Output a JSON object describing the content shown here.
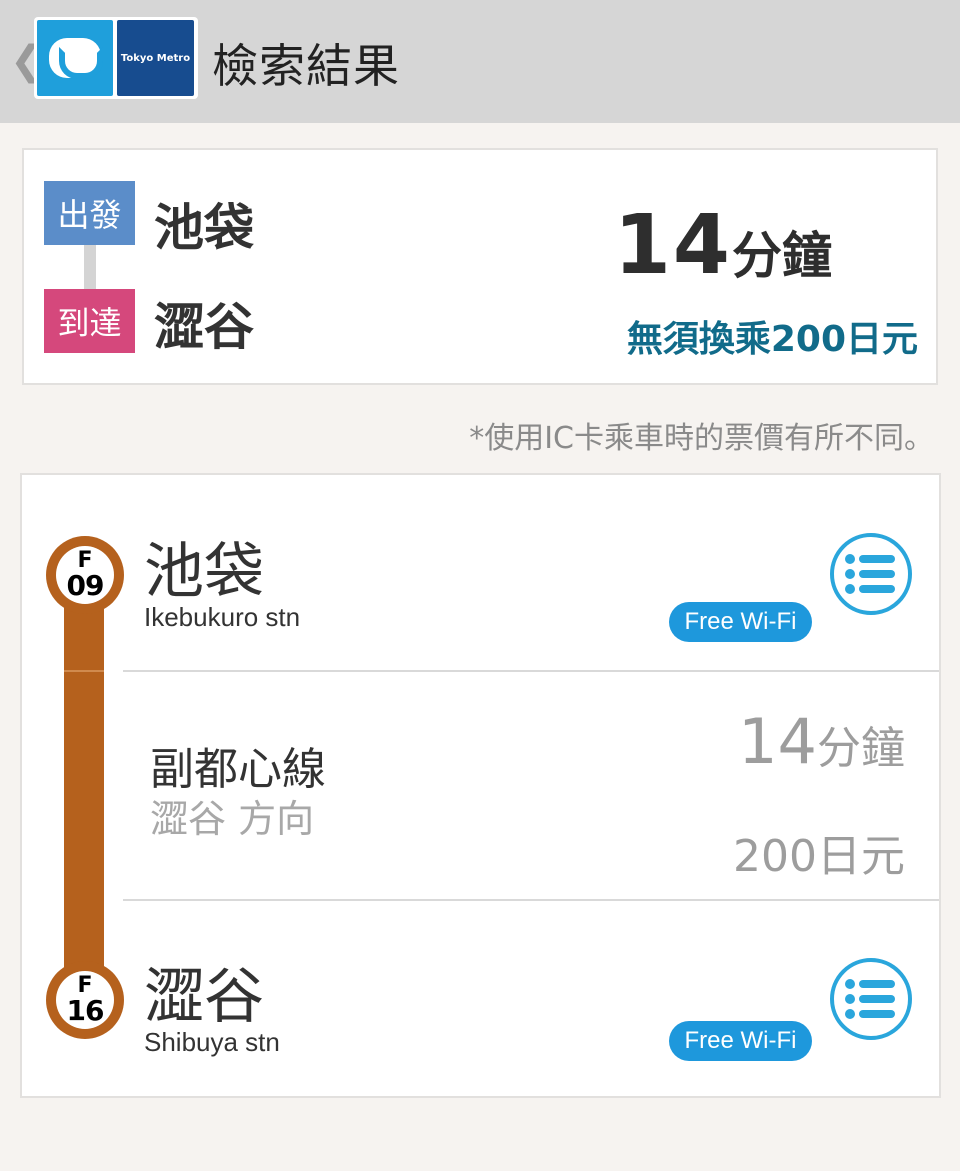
{
  "header": {
    "back_glyph": "❮",
    "logo_brand_text": "Tokyo Metro",
    "title": "檢索結果"
  },
  "summary": {
    "departure_tag": "出發",
    "departure_station": "池袋",
    "arrival_tag": "到達",
    "arrival_station": "澀谷",
    "duration_value": "14",
    "duration_unit": "分鐘",
    "fare_text": "無須換乘200日元"
  },
  "note": "*使用IC卡乘車時的票價有所不同。",
  "route": {
    "line_color": "#b5611d",
    "start": {
      "code_letter": "F",
      "code_number": "09",
      "name": "池袋",
      "name_en": "Ikebukuro stn",
      "wifi_label": "Free Wi-Fi",
      "menu_icon": "list-icon"
    },
    "segment": {
      "line_name": "副都心線",
      "direction": "澀谷 方向",
      "duration_value": "14",
      "duration_unit": "分鐘",
      "fare": "200日元"
    },
    "end": {
      "code_letter": "F",
      "code_number": "16",
      "name": "澀谷",
      "name_en": "Shibuya stn",
      "wifi_label": "Free Wi-Fi",
      "menu_icon": "list-icon"
    }
  },
  "colors": {
    "header_bg": "#d6d6d6",
    "departure_tag": "#5b8dc9",
    "arrival_tag": "#d5487c",
    "fare_accent": "#116b8a",
    "wifi_badge": "#1e98dc",
    "menu_accent": "#2aa6dc"
  }
}
